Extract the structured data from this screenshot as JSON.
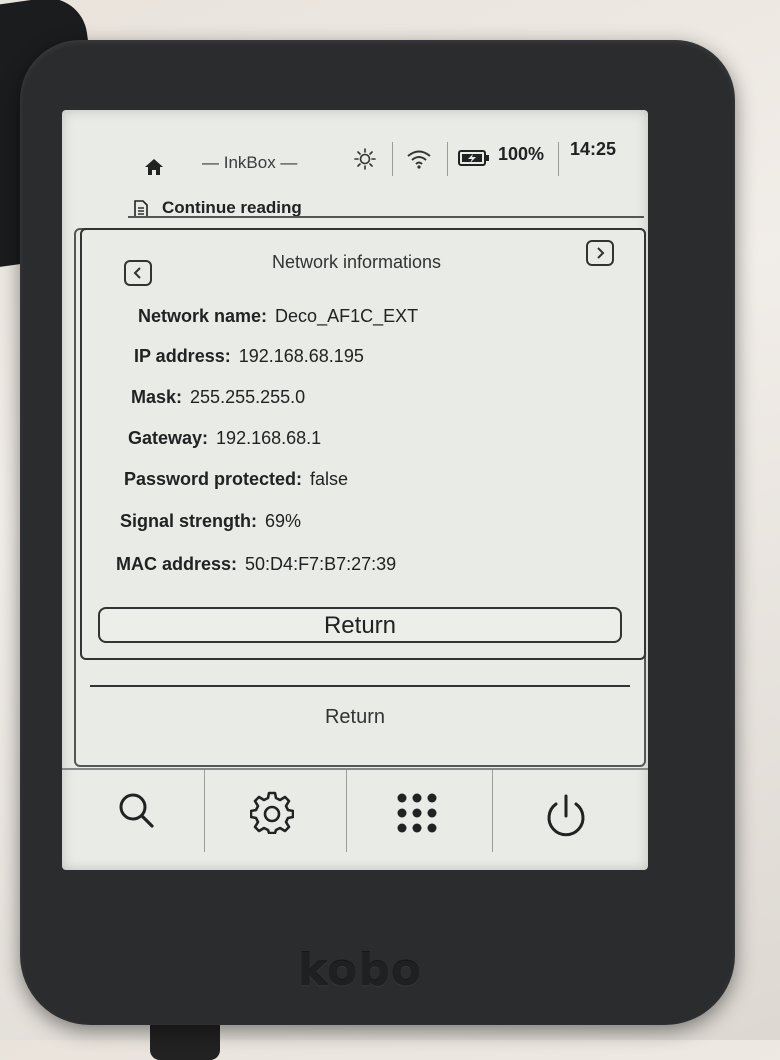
{
  "status_bar": {
    "app_title": "— InkBox —",
    "battery": "100%",
    "time": "14:25",
    "icons": [
      "home-icon",
      "brightness-icon",
      "wifi-icon",
      "battery-charging-icon"
    ]
  },
  "home": {
    "continue_reading_label": "Continue reading"
  },
  "network_dialog": {
    "title": "Network informations",
    "fields": [
      {
        "label": "Network name:",
        "value": "Deco_AF1C_EXT"
      },
      {
        "label": "IP address:",
        "value": "192.168.68.195"
      },
      {
        "label": "Mask:",
        "value": "255.255.255.0"
      },
      {
        "label": "Gateway:",
        "value": "192.168.68.1"
      },
      {
        "label": "Password protected:",
        "value": "false"
      },
      {
        "label": "Signal strength:",
        "value": "69%"
      },
      {
        "label": "MAC address:",
        "value": "50:D4:F7:B7:27:39"
      }
    ],
    "return_label": "Return"
  },
  "background_dialog": {
    "return_label": "Return"
  },
  "toolbar": {
    "icons": [
      "search-icon",
      "settings-gear-icon",
      "apps-grid-icon",
      "power-icon"
    ]
  },
  "device": {
    "brand": "kobo"
  },
  "colors": {
    "screen": "#e8ebe6",
    "bezel": "#2b2c2e",
    "ink": "#222222"
  }
}
